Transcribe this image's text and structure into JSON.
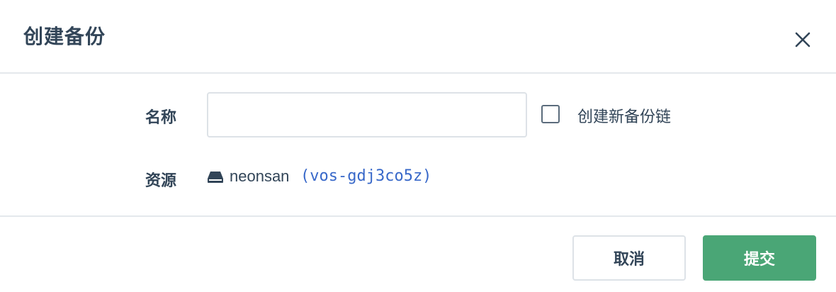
{
  "dialog": {
    "title": "创建备份"
  },
  "form": {
    "name_label": "名称",
    "name_value": "",
    "name_placeholder": "",
    "new_chain_label": "创建新备份链",
    "new_chain_checked": false,
    "resource_label": "资源",
    "resource_name": "neonsan",
    "resource_id": "(vos-gdj3co5z)"
  },
  "footer": {
    "cancel_label": "取消",
    "submit_label": "提交"
  },
  "colors": {
    "primary": "#4aa676",
    "link": "#3868c9",
    "text": "#324558",
    "border": "#dde2e7"
  },
  "icons": {
    "close": "close-icon",
    "resource": "disk-icon"
  }
}
